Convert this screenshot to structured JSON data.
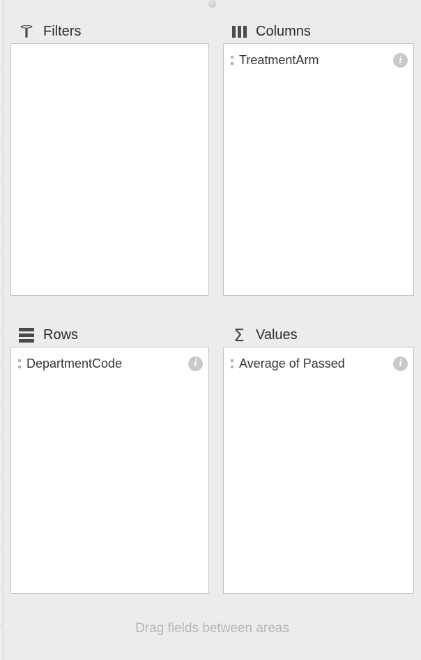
{
  "panel": {
    "grabber_icon": "drag-handle-dot",
    "footer_hint": "Drag fields between areas",
    "accent_text_color": "#2b2b2b",
    "hint_color": "#b6b6b6",
    "panel_background": "#ececec",
    "dropbox_background": "#ffffff",
    "dropbox_border_color": "#c4c4c4"
  },
  "areas": [
    {
      "id": "filters",
      "title": "Filters",
      "icon": "funnel-icon",
      "fields": []
    },
    {
      "id": "columns",
      "title": "Columns",
      "icon": "columns-icon",
      "fields": [
        {
          "label": "TreatmentArm",
          "grip_icon": "drag-grip-icon",
          "info_icon": "info-icon",
          "info_glyph": "i"
        }
      ]
    },
    {
      "id": "rows",
      "title": "Rows",
      "icon": "rows-icon",
      "fields": [
        {
          "label": "DepartmentCode",
          "grip_icon": "drag-grip-icon",
          "info_icon": "info-icon",
          "info_glyph": "i"
        }
      ]
    },
    {
      "id": "values",
      "title": "Values",
      "icon": "sigma-icon",
      "sigma_glyph": "Σ",
      "fields": [
        {
          "label": "Average of Passed",
          "grip_icon": "drag-grip-icon",
          "info_icon": "info-icon",
          "info_glyph": "i"
        }
      ]
    }
  ]
}
